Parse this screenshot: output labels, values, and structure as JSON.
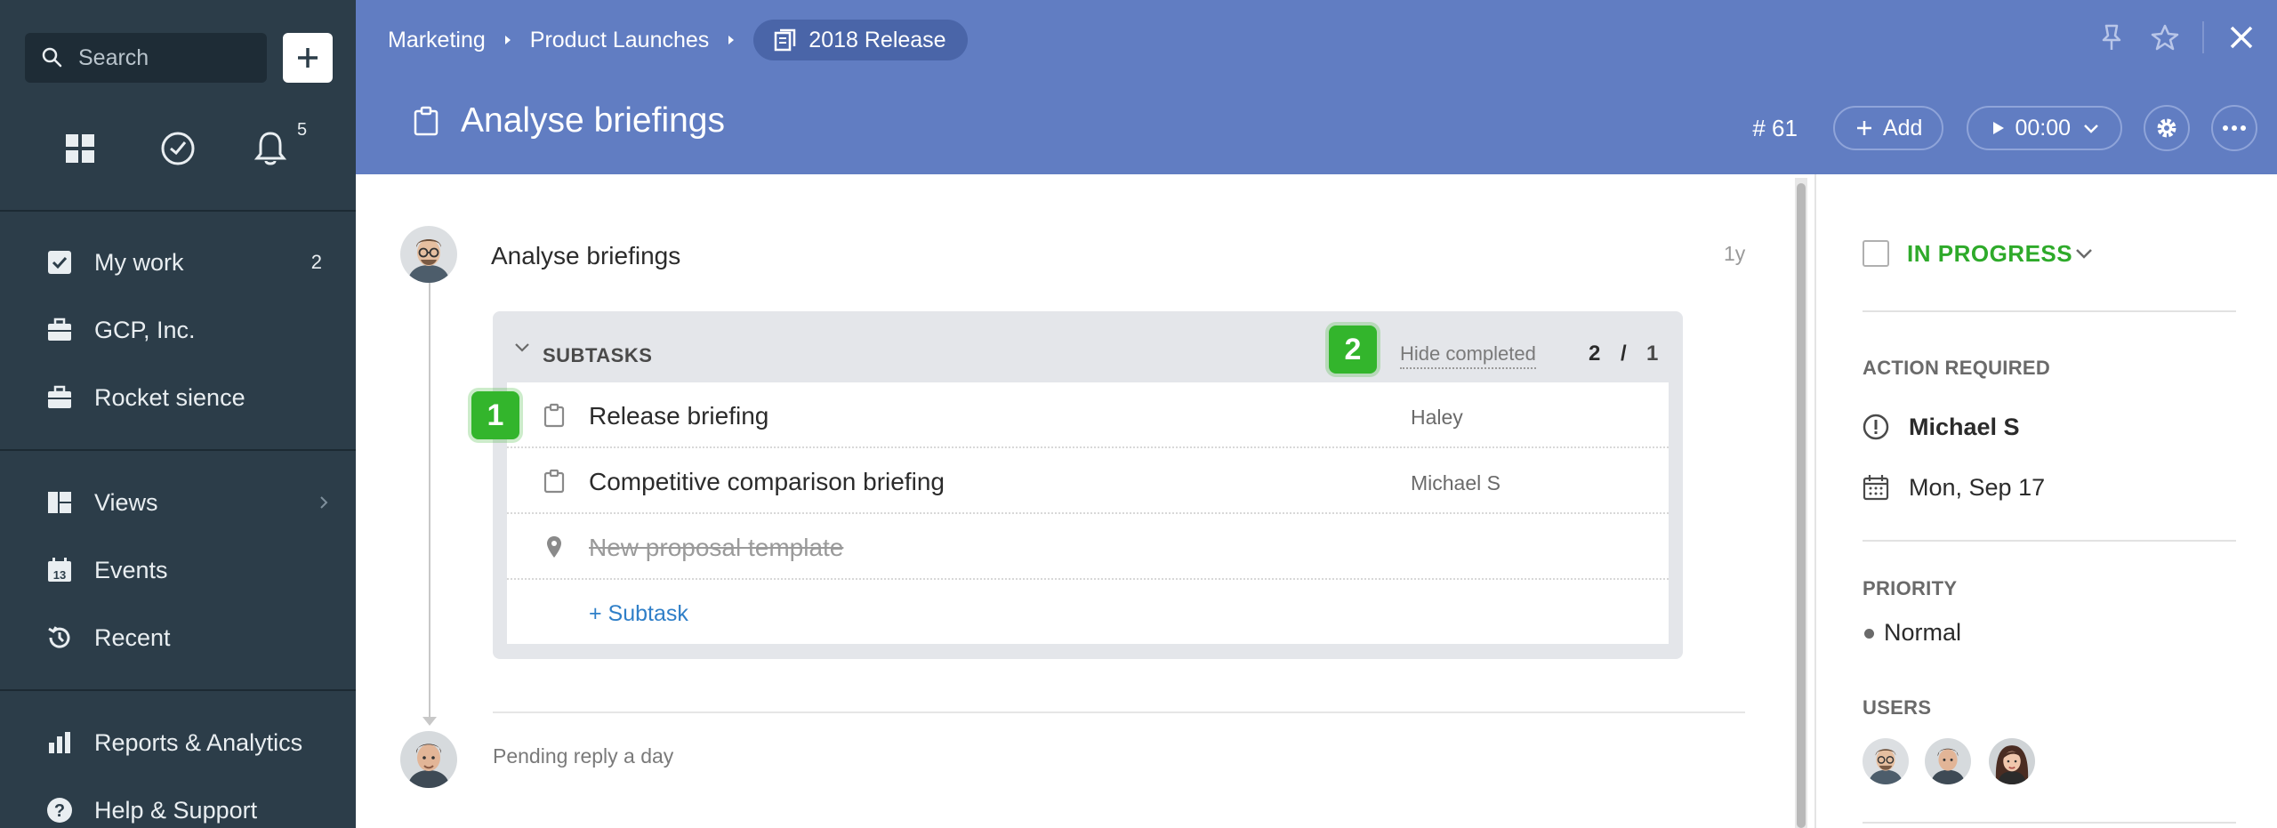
{
  "sidebar": {
    "search_placeholder": "Search",
    "notifications_count": "5",
    "nav": [
      {
        "label": "My work",
        "count": "2",
        "icon": "checkbox-icon"
      },
      {
        "label": "GCP, Inc.",
        "icon": "briefcase-icon"
      },
      {
        "label": "Rocket sience",
        "icon": "briefcase-icon"
      },
      {
        "label": "Views",
        "icon": "views-icon"
      },
      {
        "label": "Events",
        "icon": "calendar-icon"
      },
      {
        "label": "Recent",
        "icon": "history-icon"
      },
      {
        "label": "Reports & Analytics",
        "icon": "bar-chart-icon"
      },
      {
        "label": "Help & Support",
        "icon": "help-icon"
      }
    ]
  },
  "header": {
    "breadcrumb": [
      "Marketing",
      "Product Launches"
    ],
    "current_project": "2018 Release",
    "task_title": "Analyse briefings",
    "task_id": "# 61",
    "add_label": "Add",
    "timer": "00:00"
  },
  "activity": {
    "title": "Analyse briefings",
    "time": "1y",
    "pending": "Pending reply a day"
  },
  "subtasks": {
    "title": "SUBTASKS",
    "hide_completed": "Hide completed",
    "done_count": "2",
    "slash": "/",
    "total_count": "1",
    "items": [
      {
        "name": "Release briefing",
        "assignee": "Haley"
      },
      {
        "name": "Competitive comparison briefing",
        "assignee": "Michael S"
      },
      {
        "name": "New proposal template",
        "assignee": ""
      }
    ],
    "add_label": "+ Subtask"
  },
  "badges": {
    "one": "1",
    "two": "2"
  },
  "details": {
    "status": "IN PROGRESS",
    "action_required_label": "ACTION REQUIRED",
    "assignee": "Michael S",
    "due_date": "Mon, Sep 17",
    "priority_label": "PRIORITY",
    "priority": "Normal",
    "users_label": "USERS"
  },
  "colors": {
    "sidebar_bg": "#2c3d49",
    "header_bg": "#617dc2",
    "status_green": "#2eaa2a",
    "badge_green": "#33b52c",
    "link_blue": "#2f7fc8"
  }
}
